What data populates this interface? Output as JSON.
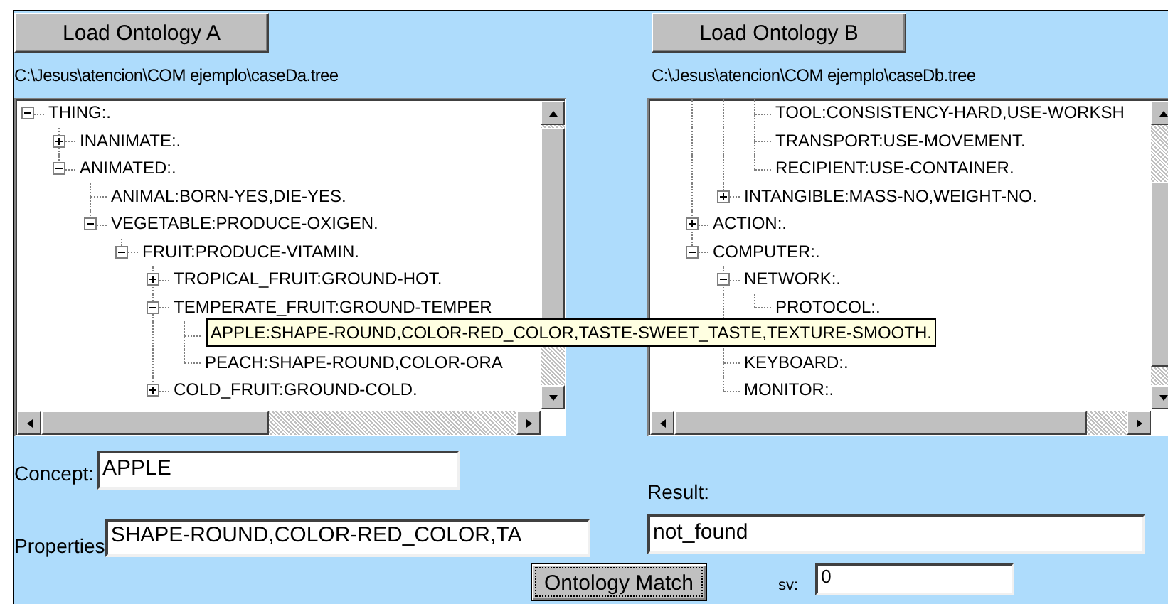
{
  "panel_a": {
    "load_button": "Load Ontology A",
    "path": "C:\\Jesus\\atencion\\COM ejemplo\\caseDa.tree",
    "tree": [
      {
        "kind": "node",
        "label": "THING:.",
        "expanded": true,
        "children": [
          {
            "kind": "node",
            "label": "INANIMATE:.",
            "expanded": false
          },
          {
            "kind": "node",
            "label": "ANIMATED:.",
            "expanded": true,
            "children": [
              {
                "kind": "node",
                "label": "ANIMAL:BORN-YES,DIE-YES."
              },
              {
                "kind": "node",
                "label": "VEGETABLE:PRODUCE-OXIGEN.",
                "expanded": true,
                "children": [
                  {
                    "kind": "node",
                    "label": "FRUIT:PRODUCE-VITAMIN.",
                    "expanded": true,
                    "children": [
                      {
                        "kind": "node",
                        "label": "TROPICAL_FRUIT:GROUND-HOT.",
                        "expanded": false
                      },
                      {
                        "kind": "node",
                        "label": "TEMPERATE_FRUIT:GROUND-TEMPER",
                        "expanded": true,
                        "children": [
                          {
                            "kind": "covered"
                          },
                          {
                            "kind": "node",
                            "label": "PEACH:SHAPE-ROUND,COLOR-ORA"
                          }
                        ]
                      },
                      {
                        "kind": "node",
                        "label": "COLD_FRUIT:GROUND-COLD.",
                        "expanded": false
                      }
                    ]
                  }
                ]
              }
            ]
          }
        ]
      }
    ]
  },
  "panel_b": {
    "load_button": "Load Ontology B",
    "path": "C:\\Jesus\\atencion\\COM ejemplo\\caseDb.tree",
    "tree": [
      {
        "kind": "offscreen",
        "children": [
          {
            "kind": "offscreen",
            "children": [
              {
                "kind": "offscreen",
                "children": [
                  {
                    "kind": "node",
                    "label": "TOOL:CONSISTENCY-HARD,USE-WORKSH"
                  },
                  {
                    "kind": "node",
                    "label": "TRANSPORT:USE-MOVEMENT."
                  },
                  {
                    "kind": "node",
                    "label": "RECIPIENT:USE-CONTAINER."
                  }
                ]
              },
              {
                "kind": "node",
                "label": "INTANGIBLE:MASS-NO,WEIGHT-NO.",
                "expanded": false
              }
            ]
          },
          {
            "kind": "node",
            "label": "ACTION:.",
            "expanded": false
          },
          {
            "kind": "node",
            "label": "COMPUTER:.",
            "expanded": true,
            "children": [
              {
                "kind": "node",
                "label": "NETWORK:.",
                "expanded": true,
                "children": [
                  {
                    "kind": "node",
                    "label": "PROTOCOL:."
                  }
                ]
              },
              {
                "kind": "covered"
              },
              {
                "kind": "node",
                "label": "KEYBOARD:."
              },
              {
                "kind": "node",
                "label": "MONITOR:."
              }
            ]
          }
        ]
      }
    ]
  },
  "tooltip": "APPLE:SHAPE-ROUND,COLOR-RED_COLOR,TASTE-SWEET_TASTE,TEXTURE-SMOOTH.",
  "concept": {
    "label": "Concept:",
    "value": "APPLE"
  },
  "properties": {
    "label": "Properties",
    "value": "SHAPE-ROUND,COLOR-RED_COLOR,TA"
  },
  "result": {
    "label": "Result:",
    "value": "not_found"
  },
  "match_button": "Ontology Match",
  "sv": {
    "label": "sv:",
    "value": "0"
  }
}
